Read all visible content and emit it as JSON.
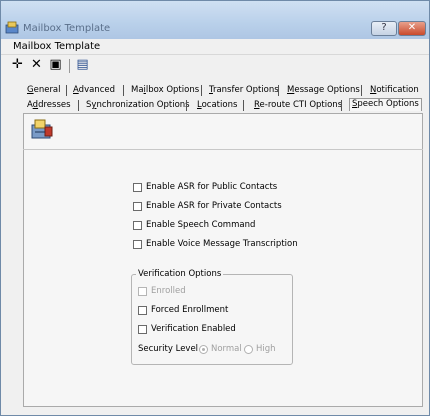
{
  "window": {
    "title": "Mailbox Template",
    "help_symbol": "?",
    "close_symbol": "✕"
  },
  "caption": "Mailbox Template",
  "toolbar": {
    "add_icon": "plus-icon",
    "add_glyph": "✛",
    "delete_icon": "x-icon",
    "delete_glyph": "✕",
    "save_icon": "floppy-icon",
    "save_glyph": "▣",
    "view_icon": "form-icon",
    "view_glyph": "▤"
  },
  "tabs_row1": [
    {
      "label": "General",
      "ul": "G"
    },
    {
      "label": "Advanced",
      "ul": "A"
    },
    {
      "label": "Mailbox Options",
      "ul": "i"
    },
    {
      "label": "Transfer Options",
      "ul": "T"
    },
    {
      "label": "Message Options",
      "ul": "M"
    },
    {
      "label": "Notification",
      "ul": "N"
    }
  ],
  "tabs_row2": [
    {
      "label": "Addresses",
      "ul": "d"
    },
    {
      "label": "Synchronization Options",
      "ul": "y"
    },
    {
      "label": "Locations",
      "ul": "L"
    },
    {
      "label": "Re-route CTI Options",
      "ul": "R"
    },
    {
      "label": "Speech Options",
      "ul": "S",
      "active": true
    }
  ],
  "options": {
    "asr_public": {
      "label": "Enable ASR for Public Contacts",
      "checked": false
    },
    "asr_private": {
      "label": "Enable ASR for Private Contacts",
      "checked": false
    },
    "speech_command": {
      "label": "Enable Speech Command",
      "checked": false
    },
    "voice_transcription": {
      "label": "Enable Voice Message Transcription",
      "checked": false
    }
  },
  "verification": {
    "title": "Verification Options",
    "enrolled": {
      "label": "Enrolled",
      "checked": false,
      "disabled": true
    },
    "forced_enrollment": {
      "label": "Forced Enrollment",
      "checked": false
    },
    "verification_enabled": {
      "label": "Verification Enabled",
      "checked": false
    },
    "security_level": {
      "label": "Security Level",
      "options": [
        "Normal",
        "High"
      ],
      "selected": "Normal",
      "disabled": true
    }
  }
}
